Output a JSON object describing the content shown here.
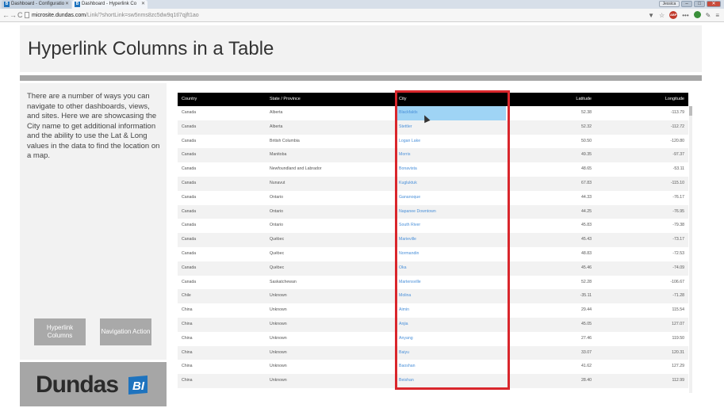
{
  "browser": {
    "tabs": [
      {
        "label": "Dashboard - Configuratio",
        "icon": "dundas-icon"
      },
      {
        "label": "Dashboard - Hyperlink Co",
        "icon": "dundas-icon"
      }
    ],
    "url_host": "microsite.dundas.com",
    "url_path": "/Link/?shortLink=sw5nms8zc5dw9q1tl7qjft1ao",
    "window_buttons": {
      "user": "Jessica",
      "minimize": "–",
      "maximize": "□",
      "close": "✕"
    }
  },
  "page": {
    "title": "Hyperlink Columns in a Table",
    "description": "There are a number of ways you can navigate to other dashboards, views, and sites. Here we are showcasing the City name to get additional information and the ability to use the Lat & Long values in the data to find the location on a map.",
    "buttons": {
      "hyperlink": "Hyperlink Columns",
      "navigation": "Navigation Action"
    },
    "logo": {
      "text": "Dundas",
      "bi": "BI"
    }
  },
  "table": {
    "columns": [
      "Country",
      "State / Province",
      "City",
      "Latitude",
      "Longitude"
    ],
    "rows": [
      [
        "Canada",
        "Alberta",
        "Blackfalds",
        "52.38",
        "-113.79"
      ],
      [
        "Canada",
        "Alberta",
        "Stettler",
        "52.32",
        "-112.72"
      ],
      [
        "Canada",
        "British Columbia",
        "Logan Lake",
        "50.50",
        "-120.80"
      ],
      [
        "Canada",
        "Manitoba",
        "Morris",
        "49.35",
        "-97.37"
      ],
      [
        "Canada",
        "Newfoundland and Labrador",
        "Bonavista",
        "48.65",
        "-53.11"
      ],
      [
        "Canada",
        "Nunavut",
        "Kugluktuk",
        "67.83",
        "-115.10"
      ],
      [
        "Canada",
        "Ontario",
        "Gananoque",
        "44.33",
        "-76.17"
      ],
      [
        "Canada",
        "Ontario",
        "Napanee Downtown",
        "44.25",
        "-76.95"
      ],
      [
        "Canada",
        "Ontario",
        "South River",
        "45.83",
        "-79.38"
      ],
      [
        "Canada",
        "Québec",
        "Marieville",
        "45.43",
        "-73.17"
      ],
      [
        "Canada",
        "Québec",
        "Normandin",
        "48.83",
        "-72.53"
      ],
      [
        "Canada",
        "Québec",
        "Oka",
        "45.46",
        "-74.09"
      ],
      [
        "Canada",
        "Saskatchewan",
        "Martensville",
        "52.28",
        "-106.67"
      ],
      [
        "Chile",
        "Unknown",
        "Molina",
        "-35.11",
        "-71.28"
      ],
      [
        "China",
        "Unknown",
        "Aimin",
        "29.44",
        "115.54"
      ],
      [
        "China",
        "Unknown",
        "Anjia",
        "45.05",
        "127.07"
      ],
      [
        "China",
        "Unknown",
        "Anyang",
        "27.46",
        "119.50"
      ],
      [
        "China",
        "Unknown",
        "Baiyu",
        "33.07",
        "120.31"
      ],
      [
        "China",
        "Unknown",
        "Baoshan",
        "41.62",
        "127.29"
      ],
      [
        "China",
        "Unknown",
        "Beishan",
        "28.40",
        "112.99"
      ]
    ],
    "selected_row": 0
  }
}
